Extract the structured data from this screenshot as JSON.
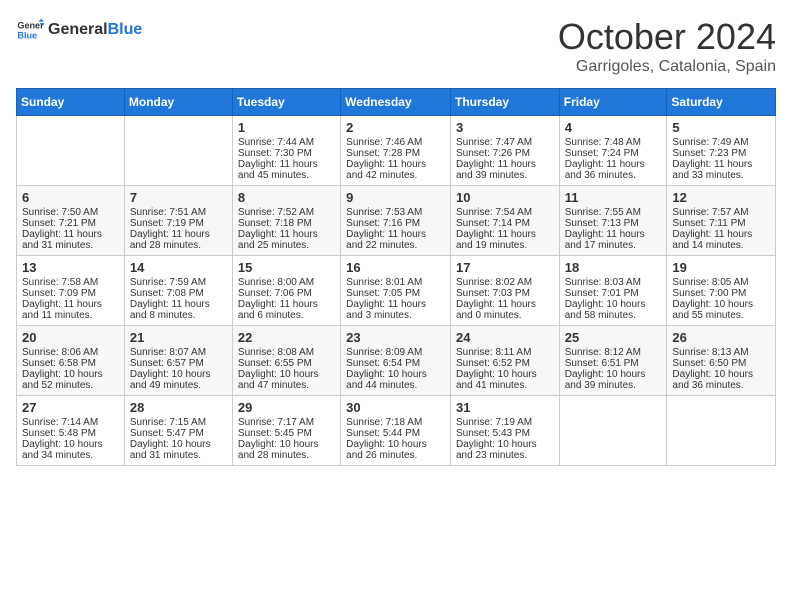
{
  "header": {
    "logo_general": "General",
    "logo_blue": "Blue",
    "month_title": "October 2024",
    "location": "Garrigoles, Catalonia, Spain"
  },
  "days_of_week": [
    "Sunday",
    "Monday",
    "Tuesday",
    "Wednesday",
    "Thursday",
    "Friday",
    "Saturday"
  ],
  "weeks": [
    [
      {
        "day": "",
        "content": ""
      },
      {
        "day": "",
        "content": ""
      },
      {
        "day": "1",
        "content": "Sunrise: 7:44 AM\nSunset: 7:30 PM\nDaylight: 11 hours and 45 minutes."
      },
      {
        "day": "2",
        "content": "Sunrise: 7:46 AM\nSunset: 7:28 PM\nDaylight: 11 hours and 42 minutes."
      },
      {
        "day": "3",
        "content": "Sunrise: 7:47 AM\nSunset: 7:26 PM\nDaylight: 11 hours and 39 minutes."
      },
      {
        "day": "4",
        "content": "Sunrise: 7:48 AM\nSunset: 7:24 PM\nDaylight: 11 hours and 36 minutes."
      },
      {
        "day": "5",
        "content": "Sunrise: 7:49 AM\nSunset: 7:23 PM\nDaylight: 11 hours and 33 minutes."
      }
    ],
    [
      {
        "day": "6",
        "content": "Sunrise: 7:50 AM\nSunset: 7:21 PM\nDaylight: 11 hours and 31 minutes."
      },
      {
        "day": "7",
        "content": "Sunrise: 7:51 AM\nSunset: 7:19 PM\nDaylight: 11 hours and 28 minutes."
      },
      {
        "day": "8",
        "content": "Sunrise: 7:52 AM\nSunset: 7:18 PM\nDaylight: 11 hours and 25 minutes."
      },
      {
        "day": "9",
        "content": "Sunrise: 7:53 AM\nSunset: 7:16 PM\nDaylight: 11 hours and 22 minutes."
      },
      {
        "day": "10",
        "content": "Sunrise: 7:54 AM\nSunset: 7:14 PM\nDaylight: 11 hours and 19 minutes."
      },
      {
        "day": "11",
        "content": "Sunrise: 7:55 AM\nSunset: 7:13 PM\nDaylight: 11 hours and 17 minutes."
      },
      {
        "day": "12",
        "content": "Sunrise: 7:57 AM\nSunset: 7:11 PM\nDaylight: 11 hours and 14 minutes."
      }
    ],
    [
      {
        "day": "13",
        "content": "Sunrise: 7:58 AM\nSunset: 7:09 PM\nDaylight: 11 hours and 11 minutes."
      },
      {
        "day": "14",
        "content": "Sunrise: 7:59 AM\nSunset: 7:08 PM\nDaylight: 11 hours and 8 minutes."
      },
      {
        "day": "15",
        "content": "Sunrise: 8:00 AM\nSunset: 7:06 PM\nDaylight: 11 hours and 6 minutes."
      },
      {
        "day": "16",
        "content": "Sunrise: 8:01 AM\nSunset: 7:05 PM\nDaylight: 11 hours and 3 minutes."
      },
      {
        "day": "17",
        "content": "Sunrise: 8:02 AM\nSunset: 7:03 PM\nDaylight: 11 hours and 0 minutes."
      },
      {
        "day": "18",
        "content": "Sunrise: 8:03 AM\nSunset: 7:01 PM\nDaylight: 10 hours and 58 minutes."
      },
      {
        "day": "19",
        "content": "Sunrise: 8:05 AM\nSunset: 7:00 PM\nDaylight: 10 hours and 55 minutes."
      }
    ],
    [
      {
        "day": "20",
        "content": "Sunrise: 8:06 AM\nSunset: 6:58 PM\nDaylight: 10 hours and 52 minutes."
      },
      {
        "day": "21",
        "content": "Sunrise: 8:07 AM\nSunset: 6:57 PM\nDaylight: 10 hours and 49 minutes."
      },
      {
        "day": "22",
        "content": "Sunrise: 8:08 AM\nSunset: 6:55 PM\nDaylight: 10 hours and 47 minutes."
      },
      {
        "day": "23",
        "content": "Sunrise: 8:09 AM\nSunset: 6:54 PM\nDaylight: 10 hours and 44 minutes."
      },
      {
        "day": "24",
        "content": "Sunrise: 8:11 AM\nSunset: 6:52 PM\nDaylight: 10 hours and 41 minutes."
      },
      {
        "day": "25",
        "content": "Sunrise: 8:12 AM\nSunset: 6:51 PM\nDaylight: 10 hours and 39 minutes."
      },
      {
        "day": "26",
        "content": "Sunrise: 8:13 AM\nSunset: 6:50 PM\nDaylight: 10 hours and 36 minutes."
      }
    ],
    [
      {
        "day": "27",
        "content": "Sunrise: 7:14 AM\nSunset: 5:48 PM\nDaylight: 10 hours and 34 minutes."
      },
      {
        "day": "28",
        "content": "Sunrise: 7:15 AM\nSunset: 5:47 PM\nDaylight: 10 hours and 31 minutes."
      },
      {
        "day": "29",
        "content": "Sunrise: 7:17 AM\nSunset: 5:45 PM\nDaylight: 10 hours and 28 minutes."
      },
      {
        "day": "30",
        "content": "Sunrise: 7:18 AM\nSunset: 5:44 PM\nDaylight: 10 hours and 26 minutes."
      },
      {
        "day": "31",
        "content": "Sunrise: 7:19 AM\nSunset: 5:43 PM\nDaylight: 10 hours and 23 minutes."
      },
      {
        "day": "",
        "content": ""
      },
      {
        "day": "",
        "content": ""
      }
    ]
  ]
}
